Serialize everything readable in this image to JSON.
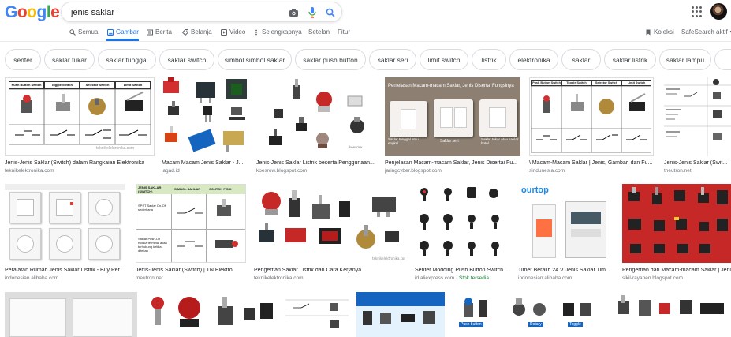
{
  "header": {
    "logo_text": [
      "G",
      "o",
      "o",
      "g",
      "l",
      "e"
    ],
    "logo_colors": [
      "#4285f4",
      "#ea4335",
      "#fbbc05",
      "#4285f4",
      "#34a853",
      "#ea4335"
    ],
    "search_value": "jenis saklar",
    "right_links": {
      "koleksi": "Koleksi",
      "safesearch": "SafeSearch aktif"
    }
  },
  "nav": {
    "tabs": [
      {
        "label": "Semua",
        "icon": "search-icon"
      },
      {
        "label": "Gambar",
        "icon": "image-icon"
      },
      {
        "label": "Berita",
        "icon": "news-icon"
      },
      {
        "label": "Belanja",
        "icon": "tag-icon"
      },
      {
        "label": "Video",
        "icon": "video-icon"
      },
      {
        "label": "Selengkapnya",
        "icon": "more-icon"
      },
      {
        "label": "Setelan",
        "icon": ""
      },
      {
        "label": "Fitur",
        "icon": ""
      }
    ],
    "active_tab": "Gambar"
  },
  "chips": [
    "senter",
    "saklar tukar",
    "saklar tunggal",
    "saklar switch",
    "simbol simbol saklar",
    "saklar push button",
    "saklar seri",
    "limit switch",
    "listrik",
    "elektronika",
    "saklar",
    "saklar listrik",
    "saklar lampu"
  ],
  "results": {
    "row1": [
      {
        "caption": "Jenis-Jenis Saklar (Switch) dalam Rangkaian Elektronika",
        "source": "teknikelektronika.com",
        "overlay": [
          "Push Button Switch",
          "Toggle Switch",
          "Selector Switch",
          "Limit Switch",
          "teknikelektronika.com"
        ]
      },
      {
        "caption": "Macam Macam Jenis Saklar - J...",
        "source": "jagad.id"
      },
      {
        "caption": "Jenis-Jenis Saklar Listrik beserta Penggunaan...",
        "source": "koesrow.blogspot.com"
      },
      {
        "caption": "Penjelasan Macam-macam Saklar, Jenis Disertai Fu...",
        "source": "jaringcyber.blogspot.com",
        "overlay": [
          "Penjelasan Macam-macam Saklar, Jenis Disertai Fungsinya",
          "Saklar tunggal atau engkel",
          "Saklar seri",
          "Saklar tukar atau saklar hotel"
        ]
      },
      {
        "caption": "\\ Macam-Macam Saklar | Jenis, Gambar, dan Fu...",
        "source": "sindunesia.com",
        "overlay": [
          "Push Button Switch",
          "Toggle Switch",
          "Selector Switch",
          "Limit Switch"
        ]
      },
      {
        "caption": "Jenis-Jenis Saklar (Swit...",
        "source": "tneutron.net"
      }
    ],
    "row2": [
      {
        "caption": "Peralatan Rumah Jenis Saklar Listrik - Buy Per...",
        "source": "indonesian.alibaba.com"
      },
      {
        "caption": "Jenis-Jenis Saklar (Switch) | TN Elektro",
        "source": "tneutron.net",
        "overlay": [
          "JENIS SAKLAR (SWITCH)",
          "SIMBOL SAKLAR",
          "CONTOH FISIK",
          "SPST Saklar On-Off sederhana",
          "Saklar Push-On Kodua terminal akan terhubung ketika ditekan"
        ]
      },
      {
        "caption": "Pengertian Saklar Listrik dan Cara Kerjanya",
        "source": "teknikelektronika.com"
      },
      {
        "caption": "Senter Modding Push Button Switch...",
        "source": "id.aliexpress.com",
        "stock": "Stok tersedia"
      },
      {
        "caption": "Timer Beralih 24 V Jenis Saklar Tim...",
        "source": "indonesian.alibaba.com",
        "overlay": [
          "ourtop"
        ]
      },
      {
        "caption": "Pengertian dan Macam-macam Saklar | Jeni...",
        "source": "sikil-rayapen.blogspot.com"
      }
    ],
    "row3_overlay": [
      "Push button",
      "Rotary",
      "Toggle"
    ]
  },
  "colors": {
    "accent": "#1a73e8",
    "red_switch": "#d32f2f",
    "bg_red": "#c62828"
  }
}
